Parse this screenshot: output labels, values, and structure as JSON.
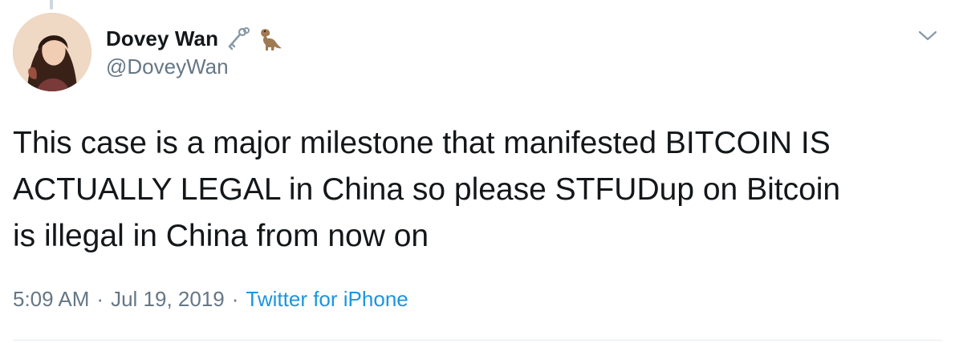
{
  "author": {
    "display_name": "Dovey Wan",
    "handle": "@DoveyWan",
    "name_emojis": [
      "key-icon",
      "dinosaur-icon"
    ]
  },
  "tweet": {
    "text": "This case is a major milestone that manifested BITCOIN IS\nACTUALLY LEGAL in China so please STFUDup on Bitcoin\nis illegal in China from now on",
    "time": "5:09 AM",
    "separator": "·",
    "date": "Jul 19, 2019",
    "source": "Twitter for iPhone"
  },
  "colors": {
    "text": "#14171a",
    "secondary": "#657786",
    "link": "#1b95e0",
    "divider": "#e6ecf0"
  }
}
